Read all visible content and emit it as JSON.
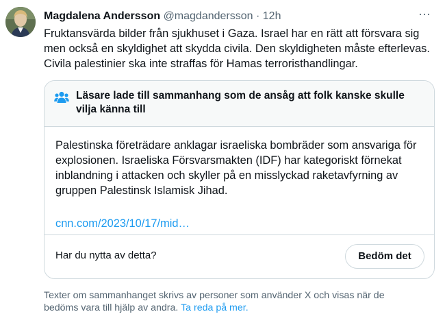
{
  "tweet": {
    "display_name": "Magdalena Andersson",
    "handle": "@magdandersson",
    "separator": "·",
    "time": "12h",
    "more_label": "···",
    "text": "Fruktansvärda bilder från sjukhuset i Gaza. Israel har en rätt att försvara sig men också en skyldighet att skydda civila. Den skyldigheten måste efterlevas. Civila palestinier ska inte straffas för Hamas terroristhandlingar."
  },
  "community_note": {
    "icon": "people-icon",
    "title": "Läsare lade till sammanhang som de ansåg att folk kanske skulle vilja känna till",
    "body": "Palestinska företrädare anklagar israeliska bombräder som ansvariga för explosionen. Israeliska Försvarsmakten (IDF) har kategoriskt förnekat inblandning i attacken och skyller på en misslyckad raketavfyrning av gruppen Palestinsk Islamisk Jihad.",
    "link": "cnn.com/2023/10/17/mid…",
    "helpful_question": "Har du nytta av detta?",
    "rate_button": "Bedöm det"
  },
  "disclaimer": {
    "text": "Texter om sammanhanget skrivs av personer som använder X och visas när de bedöms vara till hjälp av andra.",
    "learn_more": "Ta reda på mer."
  },
  "colors": {
    "text": "#0f1419",
    "secondary": "#536471",
    "link": "#1d9bf0",
    "border": "#cfd9de",
    "note_header_bg": "#f7f9f9"
  }
}
